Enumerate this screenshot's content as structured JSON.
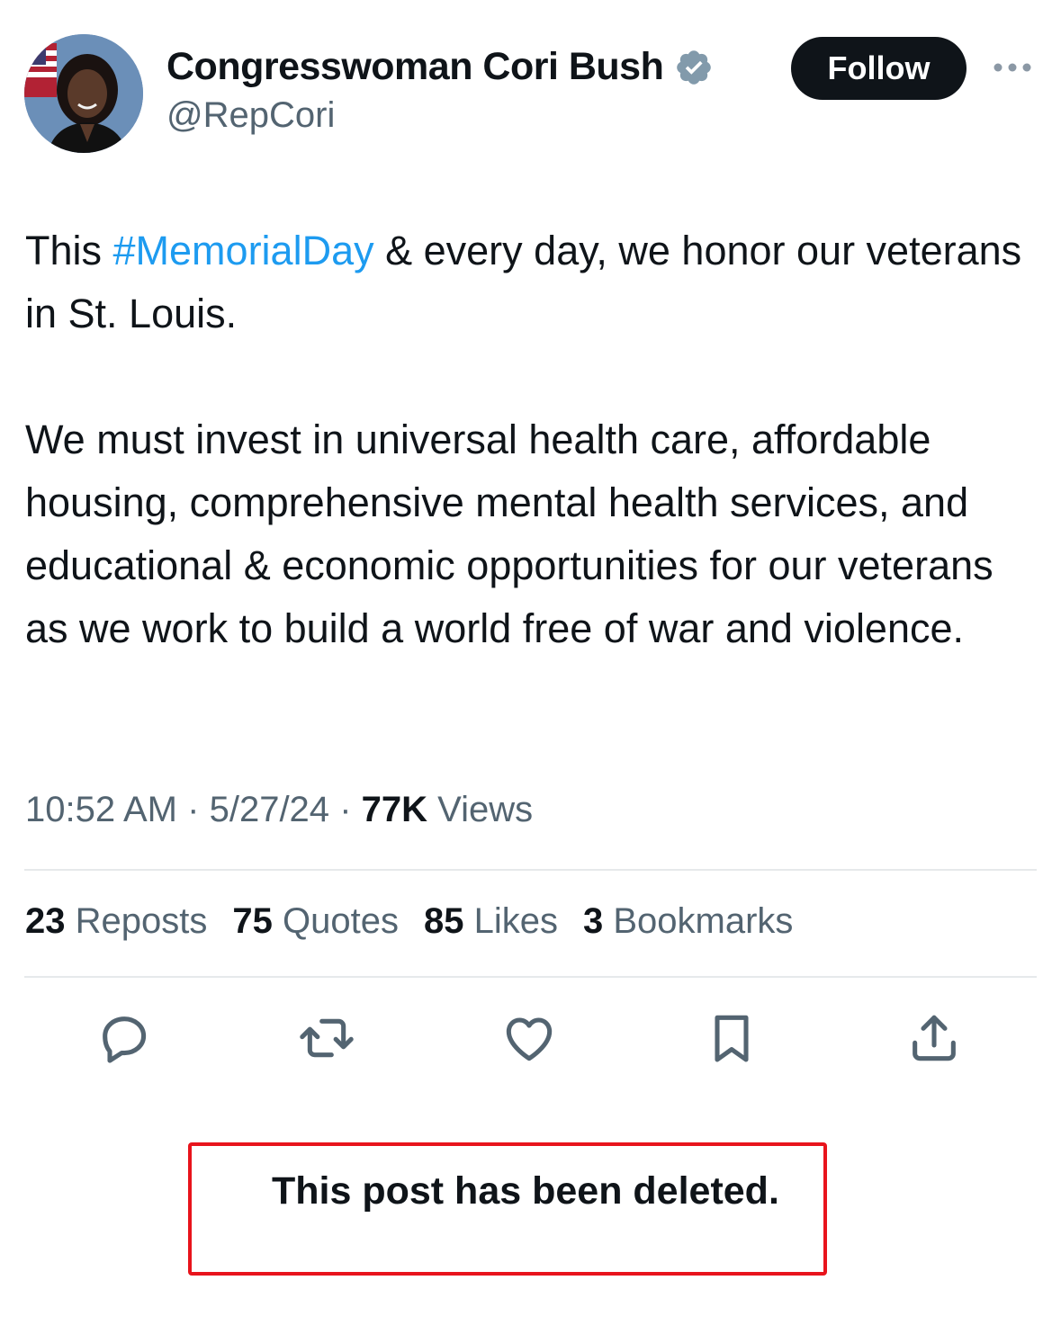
{
  "tweet": {
    "author": {
      "display_name": "Congresswoman Cori Bush",
      "handle": "@RepCori",
      "verified_icon": "verified-badge-icon"
    },
    "follow_label": "Follow",
    "text": {
      "line1_before": "This ",
      "hashtag": "#MemorialDay",
      "line1_after": " & every day, we honor our veterans in St. Louis.",
      "paragraph2": "We must invest in universal health care, affordable housing, comprehensive mental health services, and educational & economic opportunities for our veterans as we work to build a world free of war and violence."
    },
    "meta": {
      "time": "10:52 AM",
      "date": "5/27/24",
      "views_count": "77K",
      "views_label": "Views",
      "separator": "·"
    },
    "stats": [
      {
        "count": "23",
        "label": "Reposts"
      },
      {
        "count": "75",
        "label": "Quotes"
      },
      {
        "count": "85",
        "label": "Likes"
      },
      {
        "count": "3",
        "label": "Bookmarks"
      }
    ],
    "actions": [
      "reply-icon",
      "repost-icon",
      "like-icon",
      "bookmark-icon",
      "share-icon"
    ]
  },
  "annotation": {
    "deleted_notice": "This post has been deleted.",
    "box_color": "#e8141c"
  },
  "colors": {
    "hashtag": "#1d9bf0",
    "secondary_text": "#536471",
    "primary_text": "#0f1419",
    "verified": "#829aab"
  }
}
